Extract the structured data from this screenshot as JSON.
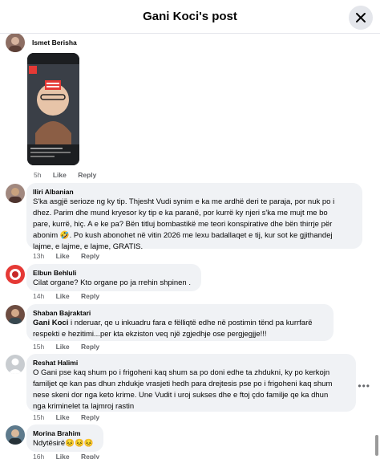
{
  "header": {
    "title": "Gani Koci's post"
  },
  "icons": {
    "close": "close-icon",
    "more": "more-horizontal-icon"
  },
  "comments": [
    {
      "author": "Ismet Berisha",
      "image_caption": "photo",
      "time": "5h",
      "like": "Like",
      "reply": "Reply"
    },
    {
      "author": "Iliri Albanian",
      "lines": [
        "S'ka asgjë serioze ng ky tip. Thjesht Vudi synim e ka me ardhë deri te paraja, por nuk po i",
        "dhez. Parim dhe mund kryesor ky tip e ka paranë, por kurrë ky njeri s'ka me mujt me bo",
        "pare, kurrë, hiç. A e ke pa? Bën titluj bombastikë me teori konspirative dhe bën thirrje për",
        "abonim 🤣. Po kush abonohet në vitin 2026 me lexu badallaqet e tij, kur sot ke gjithandej",
        "lajme, e lajme, e lajme, GRATIS."
      ],
      "time": "13h",
      "like": "Like",
      "reply": "Reply"
    },
    {
      "author": "Elbun Behluli",
      "lines": [
        "Cilat organe? Kto organe po ja rrehin shpinen ."
      ],
      "time": "14h",
      "like": "Like",
      "reply": "Reply"
    },
    {
      "author": "Shaban Bajraktari",
      "mention": "Gani Koci",
      "lines": [
        " i nderuar, qe u inkuadru fara e fëlliqtë edhe në postimin tënd pa kurrfarë",
        "respekti e hezitimi...per kta ekziston veq një zgjedhje ose pergjegjje!!!"
      ],
      "time": "15h",
      "like": "Like",
      "reply": "Reply"
    },
    {
      "author": "Reshat Halimi",
      "lines": [
        "O Gani pse kaq shum po i frigoheni kaq shum sa po doni edhe ta zhdukni, ky po kerkojn",
        "familjet qe kan pas dhun zhdukje vrasjeti hedh para drejtesis pse po i frigoheni kaq shum",
        "nese skeni dor nga keto krime. Une Vudit i uroj sukses dhe e ftoj çdo familje qe ka dhun",
        "nga kriminelet ta lajmroj rastin"
      ],
      "time": "15h",
      "like": "Like",
      "reply": "Reply"
    },
    {
      "author": "Morina Brahim",
      "lines": [
        "Ndytësirë😣😣😣"
      ],
      "time": "16h",
      "like": "Like",
      "reply": "Reply"
    }
  ]
}
